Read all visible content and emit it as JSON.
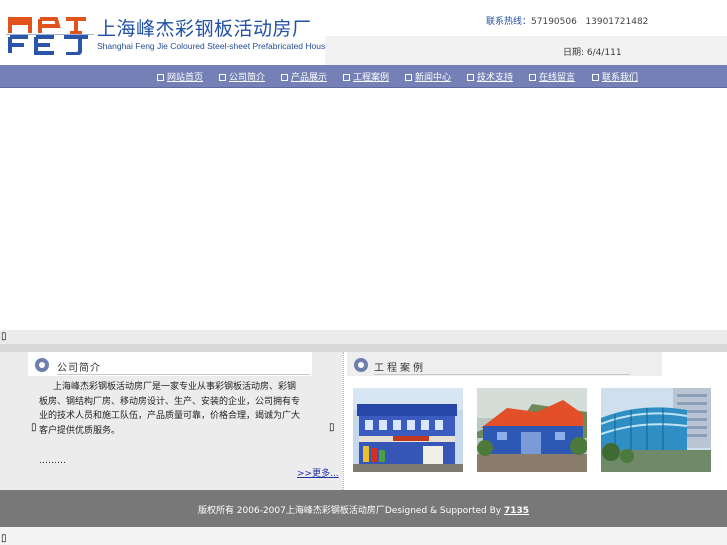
{
  "header": {
    "title": "上海峰杰彩钢板活动房厂",
    "subtitle": "Shanghai Feng Jie Coloured Steel-sheet Prefabricated House Factory",
    "hotline_label": "联系热线：",
    "hotline_numbers": "57190506   13901721482",
    "date_label": "日期:",
    "date_value": "6/4/111"
  },
  "nav": {
    "items": [
      {
        "label": "网站首页"
      },
      {
        "label": "公司简介"
      },
      {
        "label": "产品展示"
      },
      {
        "label": "工程案例"
      },
      {
        "label": "新闻中心"
      },
      {
        "label": "技术支持"
      },
      {
        "label": "在线留言"
      },
      {
        "label": "联系我们"
      }
    ]
  },
  "intro": {
    "title": "公司简介",
    "paragraph": "上海峰杰彩钢板活动房厂是一家专业从事彩钢板活动房、彩钢板房、钢结构厂房、移动房设计、生产、安装的企业，公司拥有专业的技术人员和施工队伍，产品质量可靠，价格合理，竭诚为广大客户提供优质服务。",
    "dots": "………",
    "more": ">>更多..."
  },
  "projects": {
    "title": "工程案例",
    "photos": [
      {
        "name": "case-photo-1"
      },
      {
        "name": "case-photo-2"
      },
      {
        "name": "case-photo-3"
      }
    ]
  },
  "footer": {
    "copyright": "版权所有 2006-2007上海峰杰彩钢板活动房厂Designed & Supported By ",
    "link": "7135"
  },
  "colors": {
    "nav_bg": "#7581b6",
    "footer_bg": "#787878",
    "brand_red": "#e2521c",
    "brand_blue": "#2a55a8"
  },
  "icons": [
    "logo-mark",
    "section-bullet-icon",
    "nav-box-icon",
    "missing-glyph-icon"
  ]
}
